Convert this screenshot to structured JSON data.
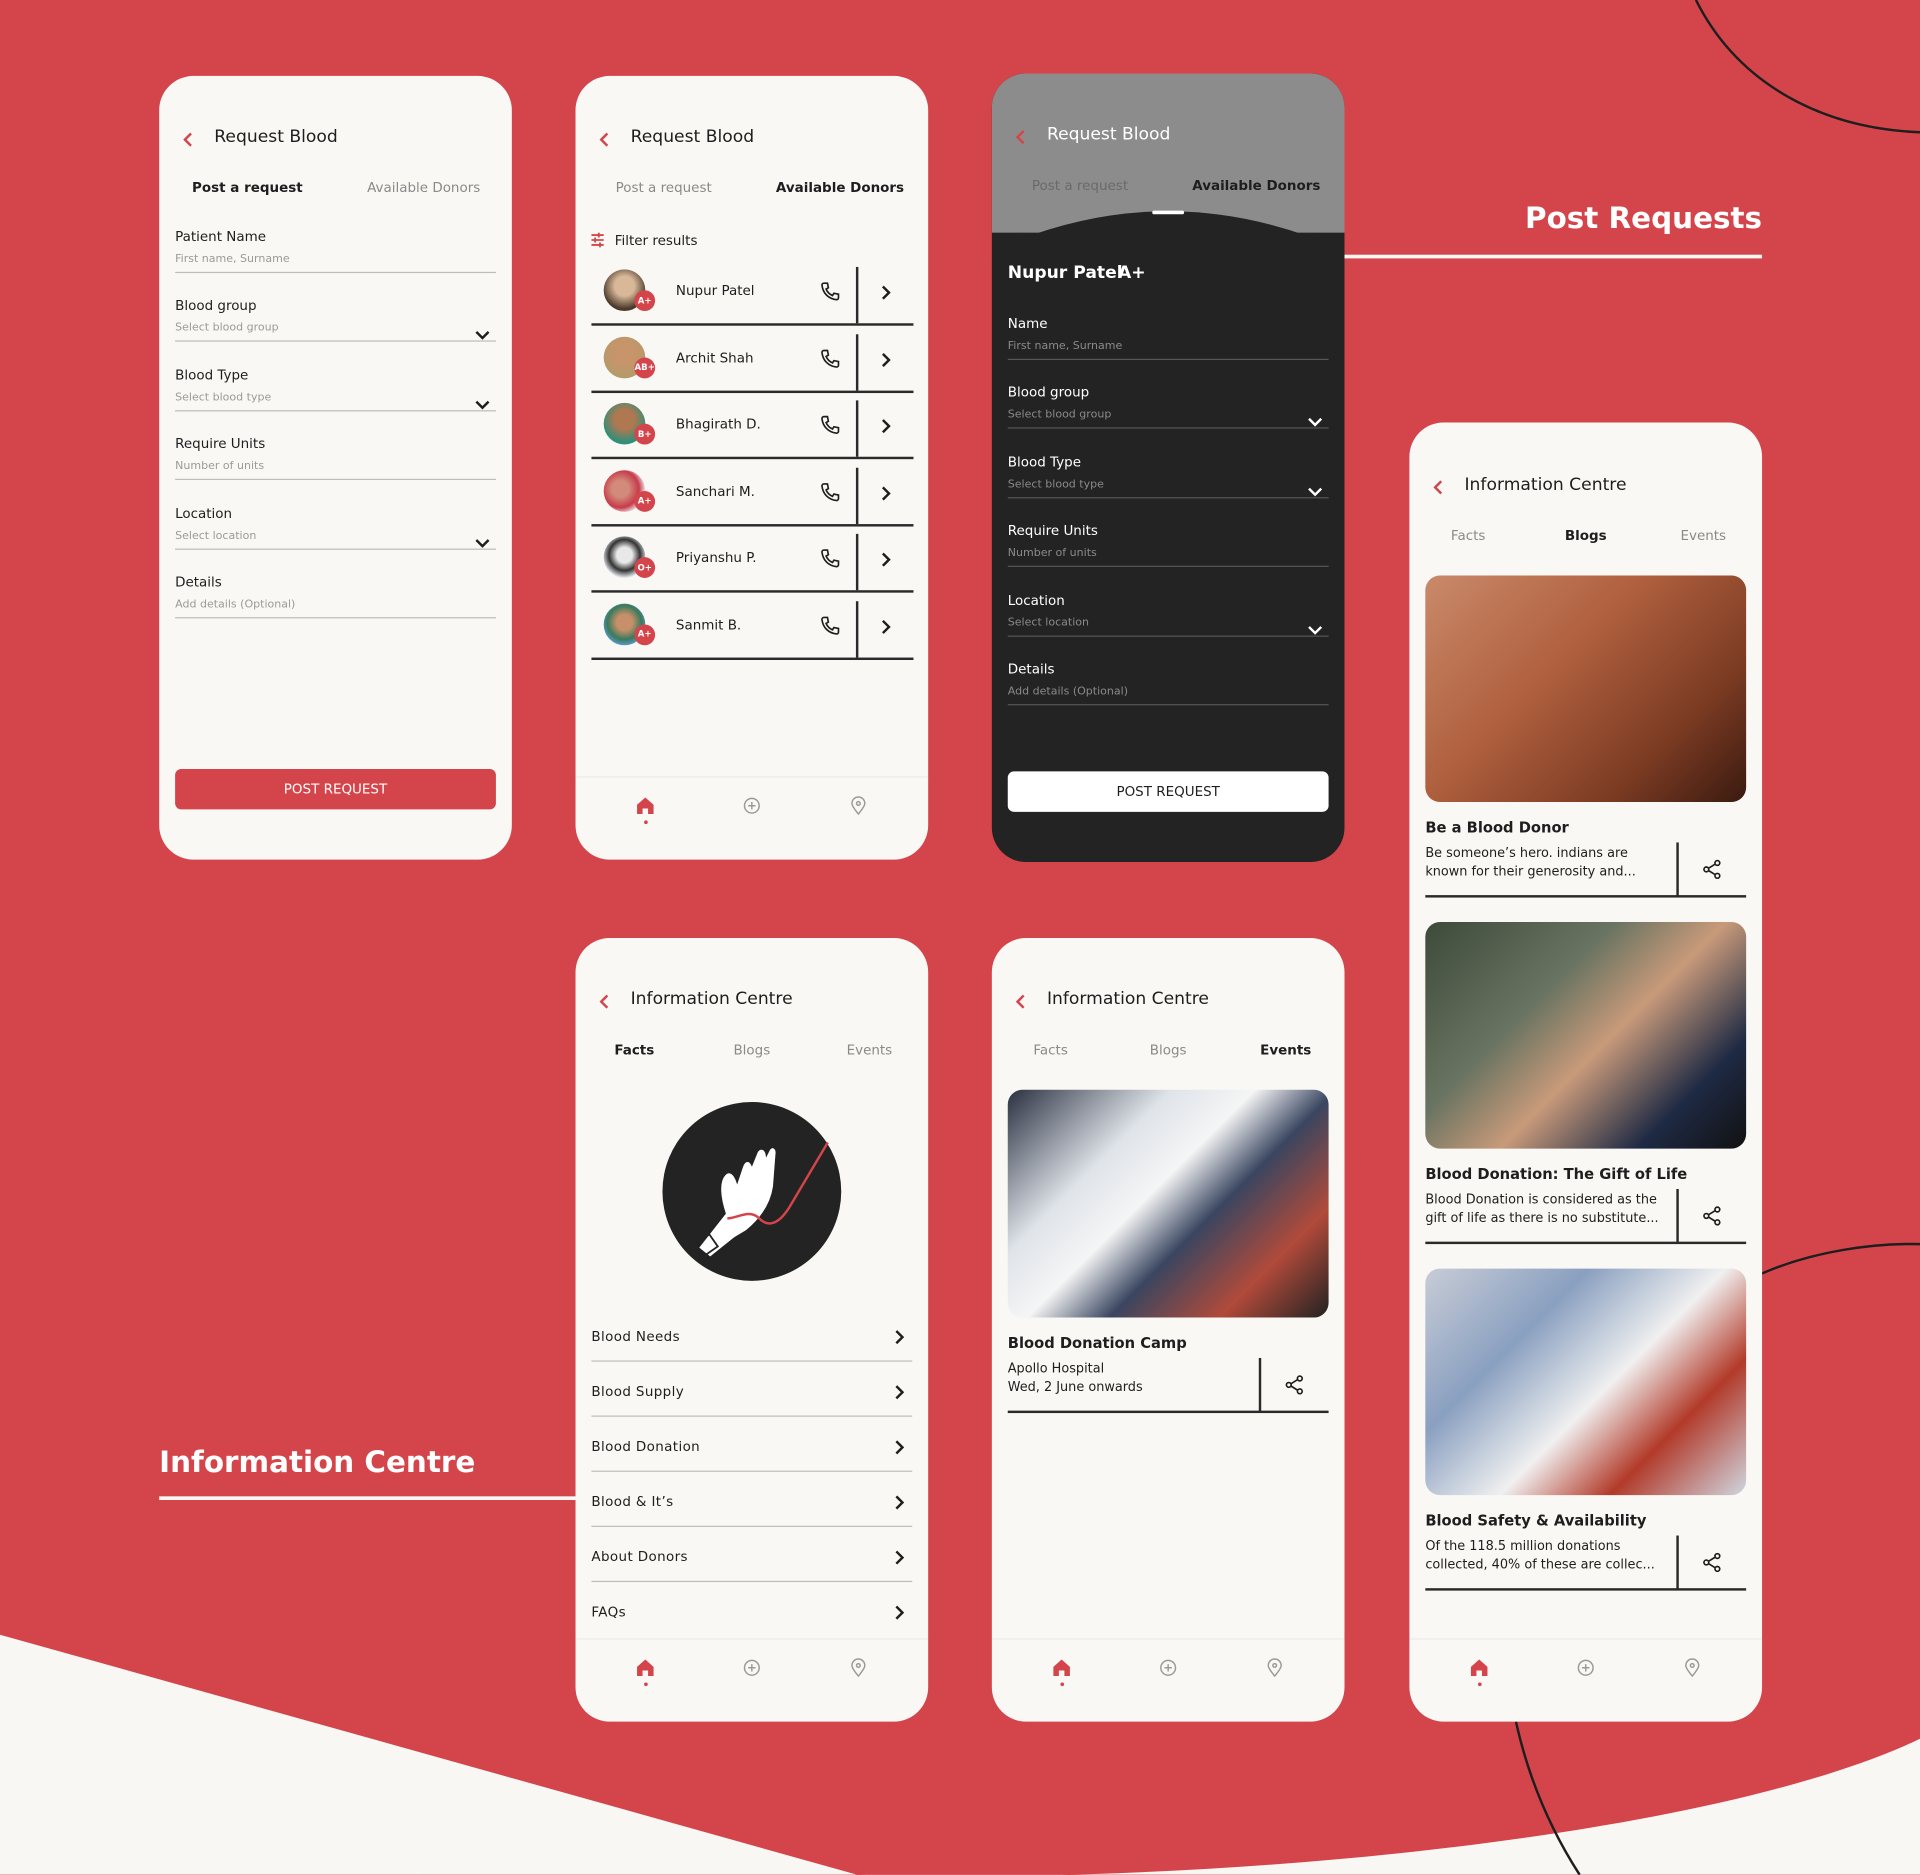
{
  "brand": {
    "accent": "#d4454b",
    "dark": "#232323",
    "surface": "#f9f8f5",
    "cream": "#f9f7f4"
  },
  "section_labels": {
    "post_requests": "Post Requests",
    "information_centre": "Information Centre"
  },
  "request_form": {
    "title": "Request Blood",
    "tabs": [
      "Post a request",
      "Available Donors"
    ],
    "active_tab": 0,
    "fields": [
      {
        "label": "Patient Name",
        "placeholder": "First name, Surname",
        "dropdown": false
      },
      {
        "label": "Blood group",
        "placeholder": "Select blood group",
        "dropdown": true
      },
      {
        "label": "Blood Type",
        "placeholder": "Select blood type",
        "dropdown": true
      },
      {
        "label": "Require Units",
        "placeholder": "Number of units",
        "dropdown": false
      },
      {
        "label": "Location",
        "placeholder": "Select location",
        "dropdown": true
      },
      {
        "label": "Details",
        "placeholder": "Add details (Optional)",
        "dropdown": false
      }
    ],
    "submit": "POST REQUEST"
  },
  "donors": {
    "title": "Request Blood",
    "tabs": [
      "Post a request",
      "Available Donors"
    ],
    "active_tab": 1,
    "filter": "Filter results",
    "list": [
      {
        "name": "Nupur Patel",
        "blood": "A+"
      },
      {
        "name": "Archit Shah",
        "blood": "AB+"
      },
      {
        "name": "Bhagirath D.",
        "blood": "B+"
      },
      {
        "name": "Sanchari M.",
        "blood": "A+"
      },
      {
        "name": "Priyanshu P.",
        "blood": "O+"
      },
      {
        "name": "Sanmit B.",
        "blood": "A+"
      }
    ]
  },
  "donor_form": {
    "title": "Request Blood",
    "tabs": [
      "Post a request",
      "Available Donors"
    ],
    "active_tab": 1,
    "donor_name": "Nupur Patel",
    "donor_blood": "A+",
    "fields": [
      {
        "label": "Name",
        "placeholder": "First name, Surname",
        "dropdown": false
      },
      {
        "label": "Blood group",
        "placeholder": "Select blood group",
        "dropdown": true
      },
      {
        "label": "Blood Type",
        "placeholder": "Select blood type",
        "dropdown": true
      },
      {
        "label": "Require Units",
        "placeholder": "Number of units",
        "dropdown": false
      },
      {
        "label": "Location",
        "placeholder": "Select location",
        "dropdown": true
      },
      {
        "label": "Details",
        "placeholder": "Add details (Optional)",
        "dropdown": false
      }
    ],
    "submit": "POST REQUEST"
  },
  "info_blogs": {
    "title": "Information Centre",
    "tabs": [
      "Facts",
      "Blogs",
      "Events"
    ],
    "active_tab": 1,
    "posts": [
      {
        "title": "Be a Blood Donor",
        "excerpt": [
          "Be someone’s hero. indians are",
          "known for their generosity and..."
        ]
      },
      {
        "title": "Blood Donation: The Gift of Life",
        "excerpt": [
          "Blood Donation is considered as the",
          "gift of life as there is no substitute..."
        ]
      },
      {
        "title": "Blood Safety & Availability",
        "excerpt": [
          "Of the 118.5 million donations",
          "collected, 40% of these are collec..."
        ]
      }
    ]
  },
  "info_facts": {
    "title": "Information Centre",
    "tabs": [
      "Facts",
      "Blogs",
      "Events"
    ],
    "active_tab": 0,
    "items": [
      "Blood Needs",
      "Blood Supply",
      "Blood Donation",
      "Blood & It’s",
      "About Donors",
      "FAQs"
    ]
  },
  "info_events": {
    "title": "Information Centre",
    "tabs": [
      "Facts",
      "Blogs",
      "Events"
    ],
    "active_tab": 2,
    "events": [
      {
        "title": "Blood Donation Camp",
        "venue": "Apollo Hospital",
        "date": "Wed, 2 June onwards"
      }
    ]
  },
  "nav": {
    "items": [
      "home-icon",
      "add-icon",
      "location-icon"
    ],
    "active": 0
  }
}
